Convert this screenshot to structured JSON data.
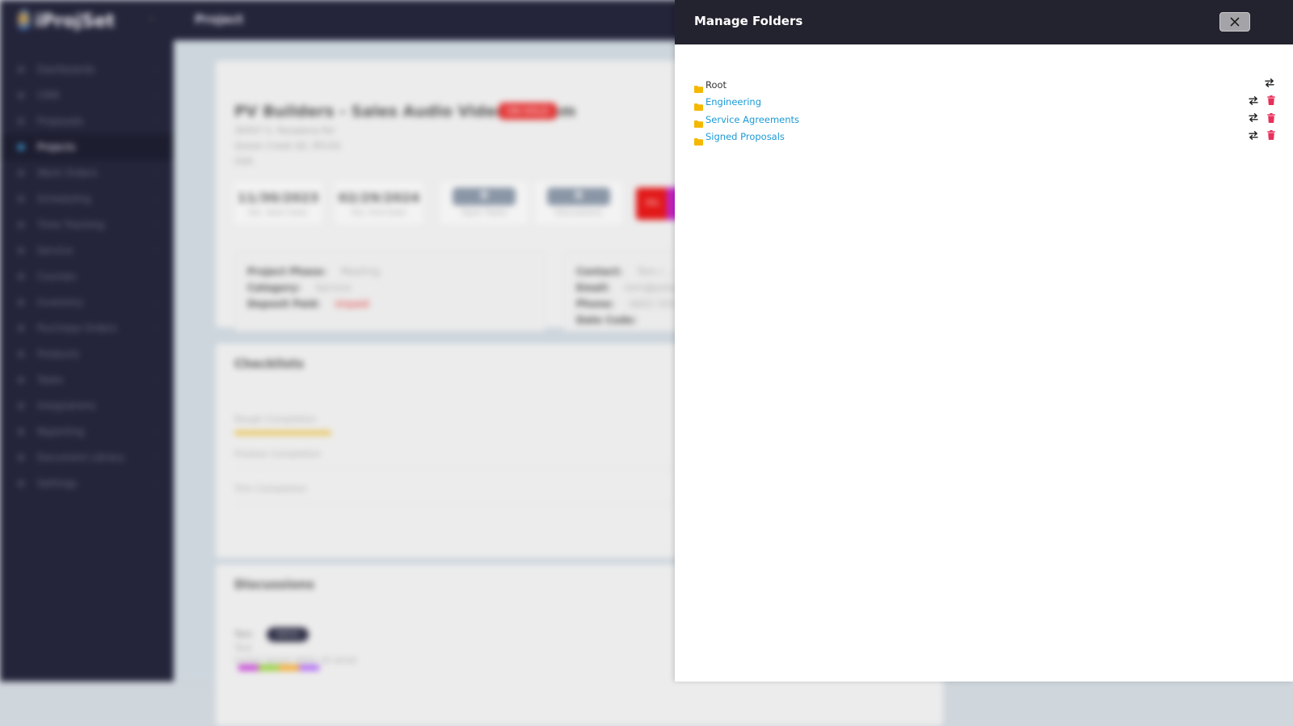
{
  "app": {
    "brand": "iProjSet",
    "page_title": "Project"
  },
  "sidebar": {
    "items": [
      {
        "label": "Dashboards",
        "has_children": true,
        "active": false
      },
      {
        "label": "CRM",
        "has_children": true,
        "active": false
      },
      {
        "label": "Proposals",
        "has_children": true,
        "active": false
      },
      {
        "label": "Projects",
        "has_children": false,
        "active": true
      },
      {
        "label": "Work Orders",
        "has_children": true,
        "active": false
      },
      {
        "label": "Scheduling",
        "has_children": true,
        "active": false
      },
      {
        "label": "Time Tracking",
        "has_children": true,
        "active": false
      },
      {
        "label": "Service",
        "has_children": true,
        "active": false
      },
      {
        "label": "Courses",
        "has_children": false,
        "active": false
      },
      {
        "label": "Inventory",
        "has_children": true,
        "active": false
      },
      {
        "label": "Purchase Orders",
        "has_children": true,
        "active": false
      },
      {
        "label": "Products",
        "has_children": false,
        "active": false
      },
      {
        "label": "Tasks",
        "has_children": true,
        "active": false
      },
      {
        "label": "Integrations",
        "has_children": false,
        "active": false
      },
      {
        "label": "Reporting",
        "has_children": true,
        "active": false
      },
      {
        "label": "Document Library",
        "has_children": true,
        "active": false
      },
      {
        "label": "Settings",
        "has_children": true,
        "active": false
      }
    ]
  },
  "project": {
    "title": "PV Builders - Sales Audio Video System",
    "status_badge": "ON HOLD",
    "address_line1": "30507 S. Pasadena Rd",
    "address_line2": "Queen Creek AZ, 85142",
    "address_line3": "USA",
    "stats": [
      {
        "value": "11/30/2023",
        "label": "Est. Start Date"
      },
      {
        "value": "02/29/2024",
        "label": "Est. End Date"
      },
      {
        "value": "0",
        "label": "Open Tasks"
      },
      {
        "value": "0",
        "label": "Discussions"
      }
    ],
    "stat_red_label": "0%",
    "info_left": [
      {
        "label": "Project Phase:",
        "value": "Meeting"
      },
      {
        "label": "Category:",
        "value": "Service"
      },
      {
        "label": "Deposit Paid:",
        "value": "Unpaid"
      }
    ],
    "info_right": [
      {
        "label": "Contact:",
        "value": "Tom / ..."
      },
      {
        "label": "Email:",
        "value": "tom@pvbuild..."
      },
      {
        "label": "Phone:",
        "value": "(602) 555-..."
      },
      {
        "label": "Date Code:",
        "value": ""
      }
    ]
  },
  "checklists": {
    "title": "Checklists",
    "rows": [
      {
        "label": "Rough Completion",
        "progress": 0.22
      },
      {
        "label": "Finalize Completion",
        "progress": 0
      },
      {
        "label": "Trim Completion",
        "progress": 0
      }
    ]
  },
  "discussions": {
    "title": "Discussions",
    "author": "Tom",
    "pill": "Admin",
    "line1": "Test",
    "line2": "Lorem ipsum dolor sit amet"
  },
  "modal": {
    "title": "Manage Folders",
    "close_label": "Close",
    "folders": [
      {
        "name": "Root",
        "is_root": true,
        "actions": [
          "move"
        ]
      },
      {
        "name": "Engineering",
        "is_root": false,
        "actions": [
          "move",
          "delete"
        ]
      },
      {
        "name": "Service Agreements",
        "is_root": false,
        "actions": [
          "move",
          "delete"
        ]
      },
      {
        "name": "Signed Proposals",
        "is_root": false,
        "actions": [
          "move",
          "delete"
        ]
      }
    ],
    "colors": {
      "header_bg": "#23232f",
      "folder_icon": "#f5b800",
      "link": "#1b9ad6",
      "delete": "#e8305a"
    }
  }
}
